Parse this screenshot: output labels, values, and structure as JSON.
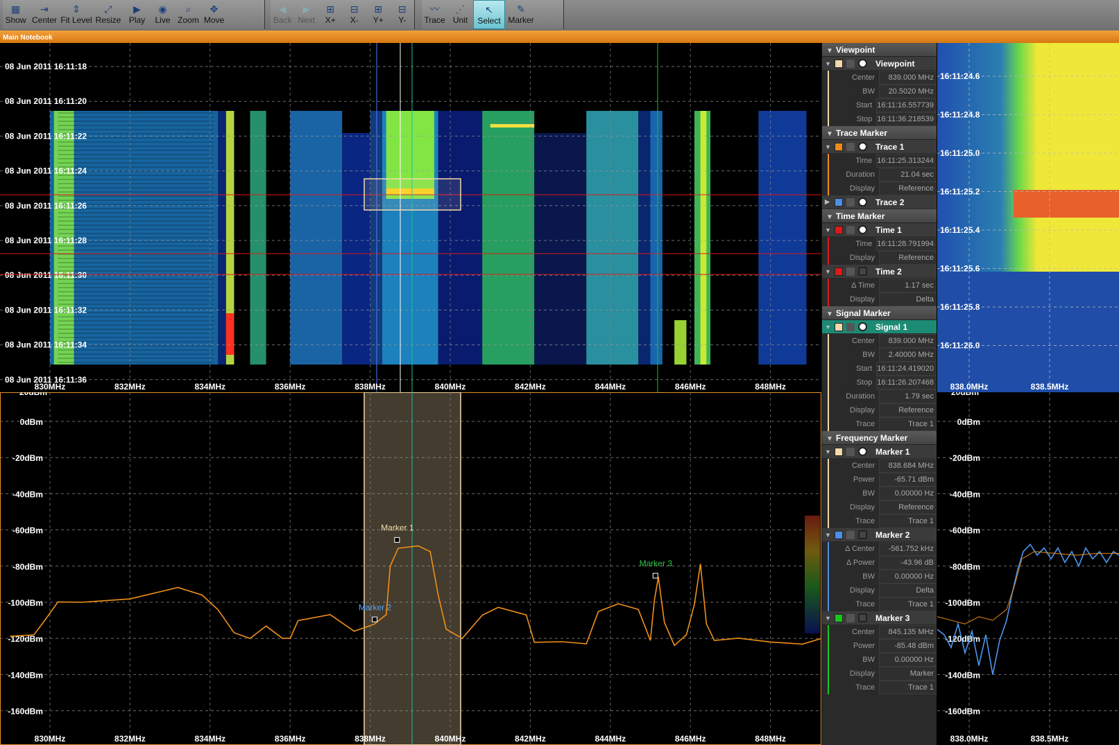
{
  "toolbar": {
    "groups": [
      [
        {
          "name": "show-button",
          "label": "Show",
          "icon": "show-icon",
          "glyph": "▦"
        },
        {
          "name": "center-button",
          "label": "Center",
          "icon": "center-icon",
          "glyph": "⇥"
        },
        {
          "name": "fit-level-button",
          "label": "Fit Level",
          "icon": "fit-level-icon",
          "glyph": "⇕"
        },
        {
          "name": "resize-button",
          "label": "Resize",
          "icon": "resize-icon",
          "glyph": "⤢"
        },
        {
          "name": "play-button",
          "label": "Play",
          "icon": "play-icon",
          "glyph": "▶"
        },
        {
          "name": "live-button",
          "label": "Live",
          "icon": "live-icon",
          "glyph": "◉"
        },
        {
          "name": "zoom-button",
          "label": "Zoom",
          "icon": "zoom-icon",
          "glyph": "⌕"
        },
        {
          "name": "move-button",
          "label": "Move",
          "icon": "move-icon",
          "glyph": "✥"
        }
      ],
      [
        {
          "name": "back-button",
          "label": "Back",
          "icon": "back-arrow-icon",
          "glyph": "◀",
          "dim": true
        },
        {
          "name": "next-button",
          "label": "Next",
          "icon": "next-arrow-icon",
          "glyph": "▶",
          "dim": true
        },
        {
          "name": "x-plus-button",
          "label": "X+",
          "icon": "x-plus-icon",
          "glyph": "⊞"
        },
        {
          "name": "x-minus-button",
          "label": "X-",
          "icon": "x-minus-icon",
          "glyph": "⊟"
        },
        {
          "name": "y-plus-button",
          "label": "Y+",
          "icon": "y-plus-icon",
          "glyph": "⊞"
        },
        {
          "name": "y-minus-button",
          "label": "Y-",
          "icon": "y-minus-icon",
          "glyph": "⊟"
        }
      ],
      [
        {
          "name": "trace-button",
          "label": "Trace",
          "icon": "trace-icon",
          "glyph": "〰"
        },
        {
          "name": "unit-button",
          "label": "Unit",
          "icon": "unit-icon",
          "glyph": "⋰"
        },
        {
          "name": "select-button",
          "label": "Select",
          "icon": "cursor-icon",
          "glyph": "↖",
          "active": true
        },
        {
          "name": "marker-button",
          "label": "Marker",
          "icon": "pencil-icon",
          "glyph": "✎"
        }
      ]
    ]
  },
  "notebook_title": "Main Notebook",
  "waterfall": {
    "time_labels": [
      "08 Jun 2011 16:11:18",
      "08 Jun 2011 16:11:20",
      "08 Jun 2011 16:11:22",
      "08 Jun 2011 16:11:24",
      "08 Jun 2011 16:11:26",
      "08 Jun 2011 16:11:28",
      "08 Jun 2011 16:11:30",
      "08 Jun 2011 16:11:32",
      "08 Jun 2011 16:11:34",
      "08 Jun 2011 16:11:36"
    ],
    "freq_labels": [
      "830MHz",
      "832MHz",
      "834MHz",
      "836MHz",
      "838MHz",
      "840MHz",
      "842MHz",
      "844MHz",
      "846MHz",
      "848MHz"
    ]
  },
  "spectrum": {
    "level_labels": [
      "0dBm",
      "-20dBm",
      "-40dBm",
      "-60dBm",
      "-80dBm",
      "-100dBm",
      "-120dBm",
      "-140dBm",
      "-160dBm"
    ],
    "top_label": "20dBm",
    "freq_labels": [
      "830MHz",
      "832MHz",
      "834MHz",
      "836MHz",
      "838MHz",
      "840MHz",
      "842MHz",
      "844MHz",
      "846MHz",
      "848MHz"
    ],
    "markers": [
      {
        "label": "Marker 1",
        "color": "#f4d9a8"
      },
      {
        "label": "Marker 2",
        "color": "#5aa0f0"
      },
      {
        "label": "Marker 3",
        "color": "#2cc84a"
      }
    ]
  },
  "side_panel": {
    "sections": [
      {
        "title": "Viewpoint",
        "items": [
          {
            "name": "Viewpoint",
            "color": "#f5d9a9",
            "eye": true,
            "open": true,
            "props": [
              [
                "Center",
                "839.000 MHz"
              ],
              [
                "BW",
                "20.5020 MHz"
              ],
              [
                "Start",
                "16:11:16.557739"
              ],
              [
                "Stop",
                "16:11:36.218539"
              ]
            ]
          }
        ]
      },
      {
        "title": "Trace Marker",
        "items": [
          {
            "name": "Trace 1",
            "color": "#f08a1a",
            "eye": true,
            "open": true,
            "props": [
              [
                "Time",
                "16:11:25.313244"
              ],
              [
                "Duration",
                "21.04 sec"
              ],
              [
                "Display",
                "Reference"
              ]
            ]
          },
          {
            "name": "Trace 2",
            "color": "#4a90e8",
            "eye": true,
            "open": false,
            "props": []
          }
        ]
      },
      {
        "title": "Time Marker",
        "items": [
          {
            "name": "Time 1",
            "color": "#e01818",
            "eye": true,
            "open": true,
            "props": [
              [
                "Time",
                "16:11:28.791994"
              ],
              [
                "Display",
                "Reference"
              ]
            ]
          },
          {
            "name": "Time 2",
            "color": "#e01818",
            "eye": false,
            "open": true,
            "props": [
              [
                "Δ Time",
                "1.17 sec"
              ],
              [
                "Display",
                "Delta"
              ]
            ]
          }
        ]
      },
      {
        "title": "Signal Marker",
        "items": [
          {
            "name": "Signal 1",
            "color": "#f5d9a9",
            "eye": true,
            "open": true,
            "selected": true,
            "props": [
              [
                "Center",
                "839.000 MHz"
              ],
              [
                "BW",
                "2.40000 MHz"
              ],
              [
                "Start",
                "16:11:24.419020"
              ],
              [
                "Stop",
                "16:11:26.207468"
              ],
              [
                "Duration",
                "1.79 sec"
              ],
              [
                "Display",
                "Reference"
              ],
              [
                "Trace",
                "Trace 1"
              ]
            ]
          }
        ]
      },
      {
        "title": "Frequency Marker",
        "items": [
          {
            "name": "Marker 1",
            "color": "#f5d9a9",
            "eye": true,
            "open": true,
            "props": [
              [
                "Center",
                "838.684 MHz"
              ],
              [
                "Power",
                "-65.71 dBm"
              ],
              [
                "BW",
                "0.00000 Hz"
              ],
              [
                "Display",
                "Reference"
              ],
              [
                "Trace",
                "Trace 1"
              ]
            ]
          },
          {
            "name": "Marker 2",
            "color": "#4a90e8",
            "eye": false,
            "open": true,
            "props": [
              [
                "Δ Center",
                "-561.752 kHz"
              ],
              [
                "Δ Power",
                "-43.96 dB"
              ],
              [
                "BW",
                "0.00000 Hz"
              ],
              [
                "Display",
                "Delta"
              ],
              [
                "Trace",
                "Trace 1"
              ]
            ]
          },
          {
            "name": "Marker 3",
            "color": "#18c818",
            "eye": false,
            "open": true,
            "props": [
              [
                "Center",
                "845.135 MHz"
              ],
              [
                "Power",
                "-85.48 dBm"
              ],
              [
                "BW",
                "0.00000 Hz"
              ],
              [
                "Display",
                "Marker"
              ],
              [
                "Trace",
                "Trace 1"
              ]
            ]
          }
        ]
      }
    ]
  },
  "zoom_view": {
    "time_labels": [
      "16:11:24.6",
      "16:11:24.8",
      "16:11:25.0",
      "16:11:25.2",
      "16:11:25.4",
      "16:11:25.6",
      "16:11:25.8",
      "16:11:26.0"
    ],
    "freq_labels": [
      "838.0MHz",
      "838.5MHz"
    ],
    "level_labels": [
      "0dBm",
      "-20dBm",
      "-40dBm",
      "-60dBm",
      "-80dBm",
      "-100dBm",
      "-120dBm",
      "-140dBm",
      "-160dBm"
    ],
    "top_label": "20dBm"
  }
}
